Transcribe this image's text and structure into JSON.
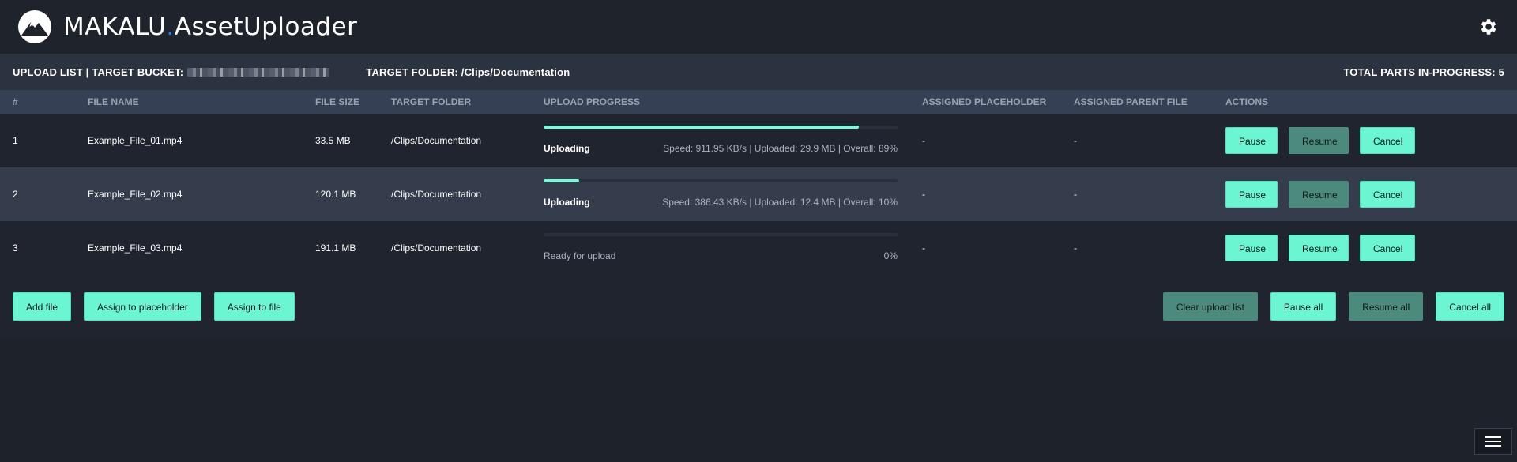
{
  "app": {
    "brand_main": "MAKALU",
    "brand_dot": ".",
    "brand_sub": "AssetUploader",
    "logo_icon": "mountain-logo-icon",
    "settings_icon": "gear-icon"
  },
  "listbar": {
    "prefix": "UPLOAD LIST | TARGET BUCKET:",
    "folder": "TARGET FOLDER: /Clips/Documentation",
    "parts": "TOTAL PARTS IN-PROGRESS: 5"
  },
  "columns": [
    "#",
    "FILE NAME",
    "FILE SIZE",
    "TARGET FOLDER",
    "UPLOAD PROGRESS",
    "ASSIGNED PLACEHOLDER",
    "ASSIGNED PARENT FILE",
    "ACTIONS"
  ],
  "rows": [
    {
      "index": "1",
      "name": "Example_File_01.mp4",
      "size": "33.5 MB",
      "folder": "/Clips/Documentation",
      "status": "Uploading",
      "detail": "Speed: 911.95 KB/s | Uploaded: 29.9 MB | Overall: 89%",
      "progress": 0.89,
      "placeholder": "-",
      "parent": "-",
      "pause": "Pause",
      "resume": "Resume",
      "cancel": "Cancel"
    },
    {
      "index": "2",
      "name": "Example_File_02.mp4",
      "size": "120.1 MB",
      "folder": "/Clips/Documentation",
      "status": "Uploading",
      "detail": "Speed: 386.43 KB/s | Uploaded: 12.4 MB | Overall: 10%",
      "progress": 0.1,
      "placeholder": "-",
      "parent": "-",
      "pause": "Pause",
      "resume": "Resume",
      "cancel": "Cancel"
    },
    {
      "index": "3",
      "name": "Example_File_03.mp4",
      "size": "191.1 MB",
      "folder": "/Clips/Documentation",
      "status": "Ready for upload",
      "detail": "0%",
      "progress": 0.0,
      "placeholder": "-",
      "parent": "-",
      "pause": "Pause",
      "resume": "Resume",
      "cancel": "Cancel"
    }
  ],
  "footer": {
    "add_file": "Add file",
    "assign_placeholder": "Assign to placeholder",
    "assign_file": "Assign to file",
    "clear_list": "Clear upload list",
    "pause_all": "Pause all",
    "resume_all": "Resume all",
    "cancel_all": "Cancel all"
  },
  "menu_icon": "hamburger-menu-icon",
  "colors": {
    "accent": "#6cf5d1",
    "accent_dim": "#4b8a7c",
    "brand_dot": "#2f80ed",
    "background": "#1d222b"
  }
}
